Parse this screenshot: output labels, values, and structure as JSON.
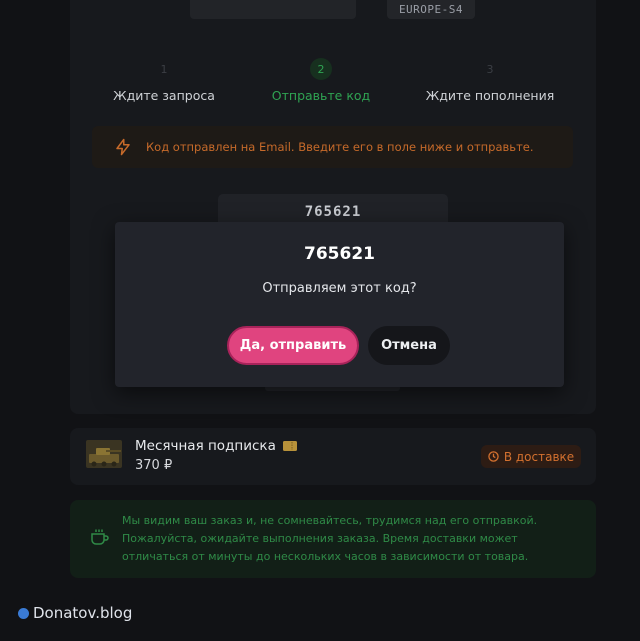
{
  "region": "EUROPE-S4",
  "steps": [
    {
      "num": "1",
      "label": "Ждите запроса"
    },
    {
      "num": "2",
      "label": "Отправьте код"
    },
    {
      "num": "3",
      "label": "Ждите пополнения"
    }
  ],
  "notice": {
    "icon": "lightning-icon",
    "text": "Код отправлен на Email. Введите его в поле ниже и отправьте."
  },
  "code_field": {
    "value": "765621"
  },
  "dialog": {
    "code": "765621",
    "question": "Отправляем этот код?",
    "confirm_label": "Да, отправить",
    "cancel_label": "Отмена"
  },
  "order": {
    "name": "Месячная подписка",
    "price": "370 ₽",
    "status": "В доставке",
    "status_icon": "clock-icon"
  },
  "info": {
    "icon": "cup-icon",
    "text": "Мы видим ваш заказ и, не сомневайтесь, трудимся над его отправкой. Пожалуйста, ожидайте выполнения заказа. Время доставки может отличаться от минуты до нескольких часов в зависимости от товара."
  },
  "watermark": "Donatov.blog",
  "colors": {
    "accent_pink": "#e0447f",
    "success_green": "#2fa352",
    "warning_orange": "#c66a2a",
    "background": "#111215"
  }
}
